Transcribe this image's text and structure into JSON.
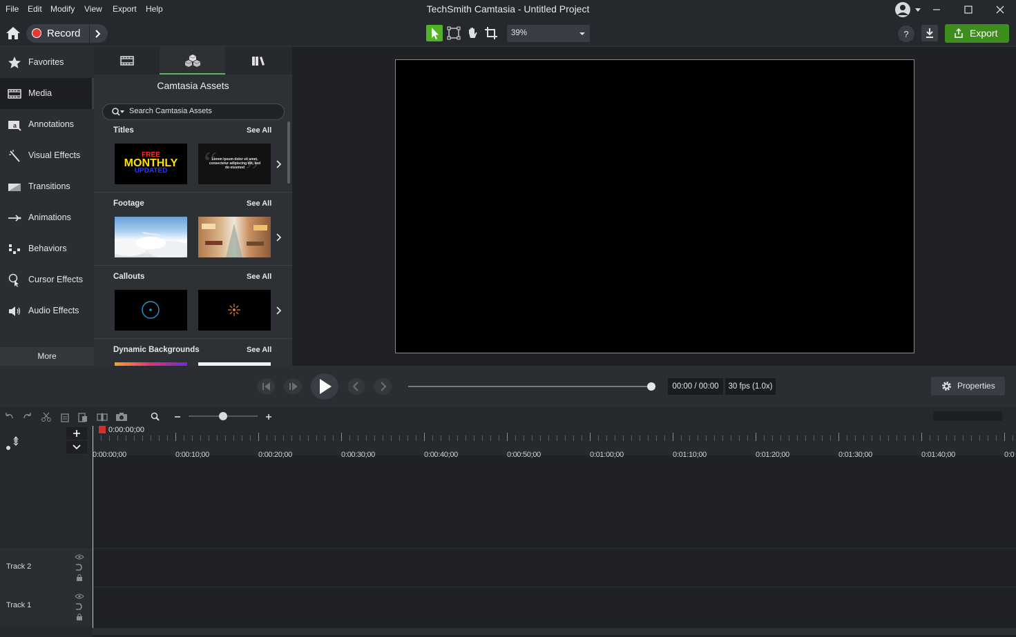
{
  "menu": [
    "File",
    "Edit",
    "Modify",
    "View",
    "Export",
    "Help"
  ],
  "app_title": "TechSmith Camtasia - Untitled Project",
  "toolbar": {
    "record_label": "Record",
    "zoom_value": "39%",
    "export_label": "Export"
  },
  "nav": {
    "items": [
      "Favorites",
      "Media",
      "Annotations",
      "Visual Effects",
      "Transitions",
      "Animations",
      "Behaviors",
      "Cursor Effects",
      "Audio Effects"
    ],
    "active": "Media",
    "more_label": "More"
  },
  "assets": {
    "title": "Camtasia Assets",
    "search_placeholder": "Search Camtasia Assets",
    "sections": [
      {
        "title": "Titles",
        "see_all": "See All"
      },
      {
        "title": "Footage",
        "see_all": "See All"
      },
      {
        "title": "Callouts",
        "see_all": "See All"
      },
      {
        "title": "Dynamic Backgrounds",
        "see_all": "See All"
      }
    ],
    "thumb_text": {
      "free": "FREE",
      "monthly": "MONTHLY",
      "updated": "UPDATED",
      "lorem": "Lorem ipsum dolor sit amet, consectetur adipiscing elit, sed do eiusmod"
    }
  },
  "playback": {
    "time": "00:00 / 00:00",
    "fps": "30 fps (1.0x)",
    "properties_label": "Properties",
    "progress": 1.0
  },
  "timeline": {
    "playhead_time": "0:00:00;00",
    "ruler": [
      "0:00:00;00",
      "0:00:10;00",
      "0:00:20;00",
      "0:00:30;00",
      "0:00:40;00",
      "0:00:50;00",
      "0:01:00;00",
      "0:01:10;00",
      "0:01:20;00",
      "0:01:30;00",
      "0:01:40;00",
      "0:0"
    ],
    "tracks": [
      "Track 2",
      "Track 1"
    ]
  },
  "colors": {
    "accent_green": "#3e8e1e",
    "record_red": "#e53935",
    "active_tool_green": "#52b226"
  }
}
